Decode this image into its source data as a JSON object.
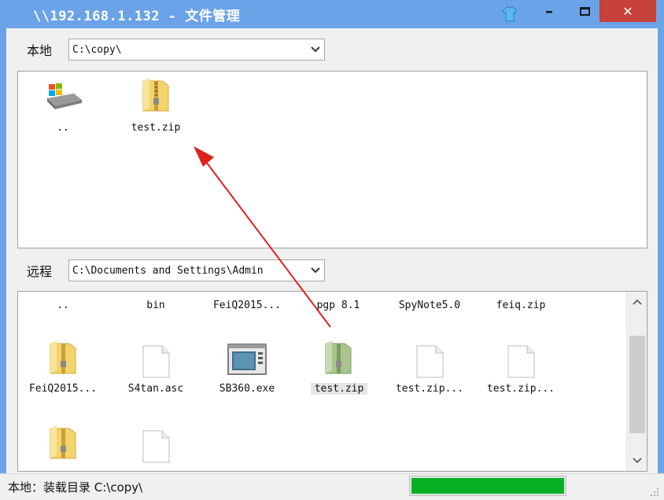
{
  "window": {
    "title": "\\\\192.168.1.132 - 文件管理",
    "minimize_label": "–",
    "close_label": "✕"
  },
  "local": {
    "label": "本地",
    "path": "C:\\copy\\",
    "items": [
      {
        "name": "..",
        "icon": "windows-drive-icon"
      },
      {
        "name": "test.zip",
        "icon": "zip-folder-icon"
      }
    ]
  },
  "remote": {
    "label": "远程",
    "path": "C:\\Documents and Settings\\Admin",
    "row1": [
      "..",
      "bin",
      "FeiQ2015...",
      "pgp 8.1",
      "SpyNote5.0",
      "feiq.zip"
    ],
    "row2": [
      {
        "name": "FeiQ2015...",
        "icon": "zip-folder-icon"
      },
      {
        "name": "S4tan.asc",
        "icon": "blank-file-icon"
      },
      {
        "name": "SB360.exe",
        "icon": "exe-window-icon"
      },
      {
        "name": "test.zip",
        "icon": "zip-folder-green-icon"
      },
      {
        "name": "test.zip...",
        "icon": "blank-file-icon"
      },
      {
        "name": "test.zip...",
        "icon": "blank-file-icon"
      }
    ]
  },
  "status": {
    "text": "本地：装载目录 C:\\copy\\",
    "progress": 1.0
  },
  "colors": {
    "title_bar": "#6aa3e8",
    "close_button": "#c7403a",
    "progress_fill": "#06b025",
    "annotation_arrow": "#e0201c"
  }
}
